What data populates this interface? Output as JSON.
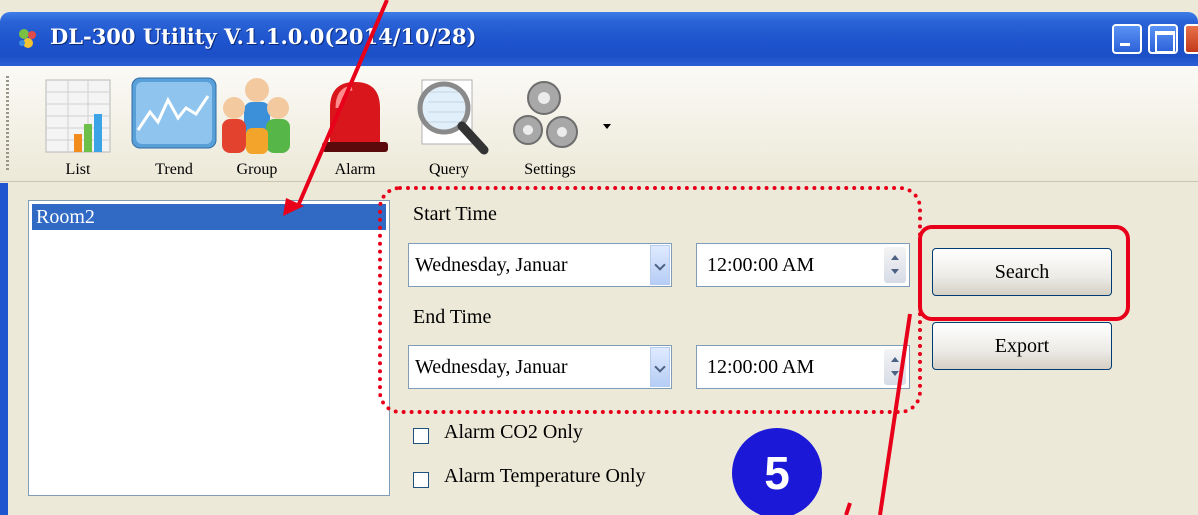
{
  "window": {
    "title": "DL-300 Utility V.1.1.0.0(2014/10/28)"
  },
  "toolbar": {
    "items": [
      {
        "label": "List",
        "icon": "list-icon"
      },
      {
        "label": "Trend",
        "icon": "trend-icon"
      },
      {
        "label": "Group",
        "icon": "group-icon"
      },
      {
        "label": "Alarm",
        "icon": "alarm-icon"
      },
      {
        "label": "Query",
        "icon": "query-icon"
      },
      {
        "label": "Settings",
        "icon": "settings-icon"
      }
    ]
  },
  "device_list": {
    "items": [
      "Room2"
    ]
  },
  "query": {
    "start_label": "Start Time",
    "start_date": "Wednesday,   Januar",
    "start_time": "12:00:00 AM",
    "end_label": "End Time",
    "end_date": "Wednesday,   Januar",
    "end_time": "12:00:00 AM",
    "search_button": "Search",
    "export_button": "Export",
    "alarm_co2_label": "Alarm CO2 Only",
    "alarm_co2_checked": false,
    "alarm_temp_label": "Alarm Temperature Only",
    "alarm_temp_checked": false
  },
  "annotation": {
    "step": "5",
    "color": "#e8001a",
    "badge_color": "#1b18d8"
  }
}
